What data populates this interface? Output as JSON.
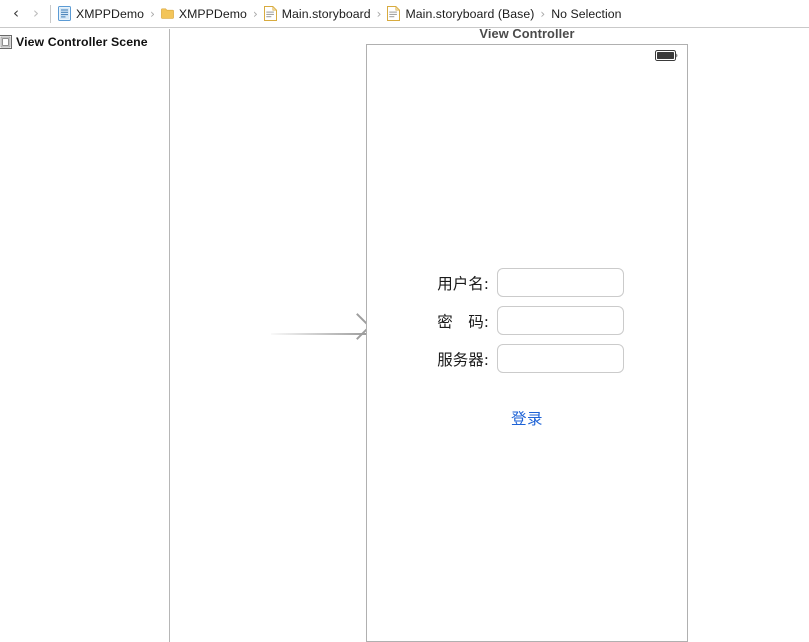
{
  "jumpbar": {
    "back_icon": "chevron-left-icon",
    "back_glyph": "‹",
    "forward_icon": "chevron-right-icon",
    "forward_glyph": "›",
    "separator": "›",
    "crumbs": [
      {
        "label": "XMPPDemo",
        "icon": "xcode-project-icon"
      },
      {
        "label": "XMPPDemo",
        "icon": "folder-icon"
      },
      {
        "label": "Main.storyboard",
        "icon": "storyboard-file-icon"
      },
      {
        "label": "Main.storyboard (Base)",
        "icon": "storyboard-file-icon"
      },
      {
        "label": "No Selection",
        "icon": "none"
      }
    ]
  },
  "outline": {
    "items": [
      {
        "label": "View Controller Scene",
        "icon": "view-controller-scene-icon"
      }
    ]
  },
  "canvas": {
    "scene_title": "View Controller",
    "status_bar": {
      "battery_icon": "battery-full-icon"
    },
    "form": {
      "fields": [
        {
          "label": "用户名:",
          "value": "",
          "placeholder": "",
          "name": "username"
        },
        {
          "label": "密　码:",
          "value": "",
          "placeholder": "",
          "name": "password"
        },
        {
          "label": "服务器:",
          "value": "",
          "placeholder": "",
          "name": "server"
        }
      ],
      "login_label": "登录"
    },
    "entry_arrow_icon": "initial-view-controller-arrow"
  },
  "colors": {
    "tint_blue": "#1d62d6",
    "field_border": "#cbcbcb",
    "device_border": "#b0b0b0",
    "divider": "#c9c9c9",
    "arrow_gray": "#9e9e9e",
    "title_gray": "#4a4a4a"
  }
}
